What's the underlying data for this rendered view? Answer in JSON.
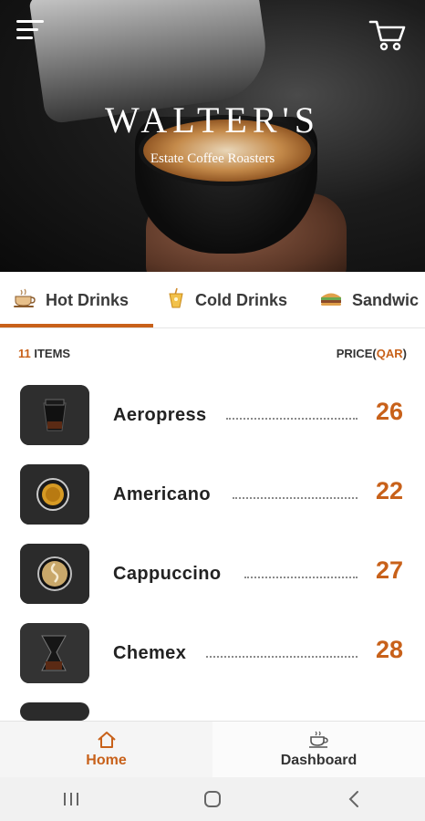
{
  "header": {
    "brand_title": "WALTER'S",
    "brand_subtitle": "Estate Coffee Roasters",
    "menu_icon": "hamburger-menu-icon",
    "cart_icon": "shopping-cart-icon"
  },
  "tabs": [
    {
      "label": "Hot Drinks",
      "icon": "hot-coffee-icon",
      "selected": true
    },
    {
      "label": "Cold Drinks",
      "icon": "cold-drink-icon",
      "selected": false
    },
    {
      "label": "Sandwic",
      "icon": "sandwich-icon",
      "selected": false
    }
  ],
  "list_header": {
    "count": "11",
    "items_label": " ITEMS",
    "price_label": "PRICE(",
    "currency": "QAR",
    "price_close": ")"
  },
  "items": [
    {
      "name": "Aeropress",
      "price": "26",
      "thumb_icon": "aeropress-brewer-icon"
    },
    {
      "name": "Americano",
      "price": "22",
      "thumb_icon": "americano-cup-icon"
    },
    {
      "name": "Cappuccino",
      "price": "27",
      "thumb_icon": "cappuccino-cup-icon"
    },
    {
      "name": "Chemex",
      "price": "28",
      "thumb_icon": "chemex-brewer-icon"
    }
  ],
  "bottom_nav": {
    "home_label": "Home",
    "dashboard_label": "Dashboard"
  },
  "colors": {
    "accent": "#c8611a",
    "text": "#222222",
    "nav_bg": "#f5f5f5"
  }
}
